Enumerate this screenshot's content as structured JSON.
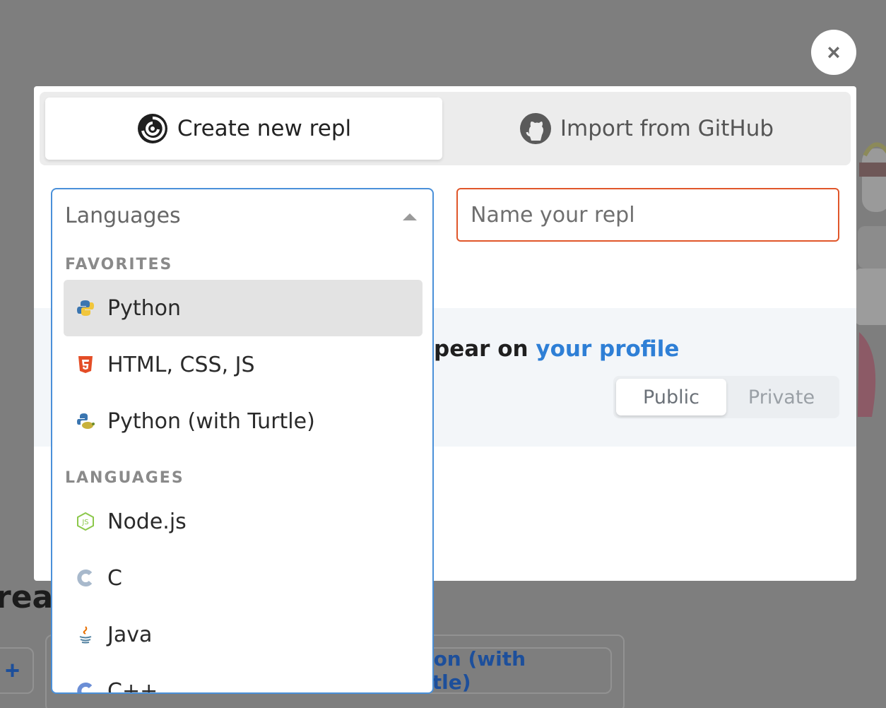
{
  "background": {
    "heading": "reat",
    "plus_button": "+",
    "turtle_button": "ython (with Turtle)"
  },
  "close": {
    "label": "×"
  },
  "tabs": [
    {
      "label": "Create new repl",
      "icon": "replit-logo-icon",
      "active": true
    },
    {
      "label": "Import from GitHub",
      "icon": "github-icon",
      "active": false
    }
  ],
  "language_select": {
    "placeholder": "Languages"
  },
  "name_input": {
    "placeholder": "Name your repl",
    "value": ""
  },
  "privacy": {
    "text_before": "pear on ",
    "link": "your profile",
    "options": [
      "Public",
      "Private"
    ],
    "selected": "Public"
  },
  "dropdown": {
    "favorites_label": "FAVORITES",
    "favorites": [
      {
        "label": "Python",
        "icon": "python-icon",
        "highlighted": true
      },
      {
        "label": "HTML, CSS, JS",
        "icon": "html5-icon"
      },
      {
        "label": "Python (with Turtle)",
        "icon": "python-turtle-icon"
      }
    ],
    "languages_label": "LANGUAGES",
    "languages": [
      {
        "label": "Node.js",
        "icon": "nodejs-icon"
      },
      {
        "label": "C",
        "icon": "c-icon"
      },
      {
        "label": "Java",
        "icon": "java-icon"
      },
      {
        "label": "C++",
        "icon": "cpp-icon"
      }
    ]
  },
  "colors": {
    "accent_blue": "#4a90d9",
    "input_error_orange": "#e0562a",
    "link_blue": "#2e7fd6",
    "overlay_gray": "#7e7e7e"
  }
}
